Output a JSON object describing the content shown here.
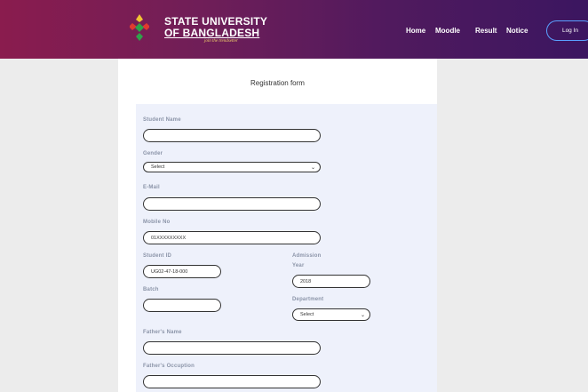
{
  "header": {
    "brand_line1": "STATE UNIVERSITY",
    "brand_line2": "OF BANGLADESH",
    "brand_tagline": "join the trendsetter",
    "nav": [
      "Home",
      "Moodle",
      "Result",
      "Notice"
    ],
    "login_label": "Log In"
  },
  "form": {
    "title": "Registration form",
    "student_name": {
      "label": "Student Name",
      "value": ""
    },
    "gender": {
      "label": "Gender",
      "value": "Select"
    },
    "email": {
      "label": "E-Mail",
      "value": ""
    },
    "mobile": {
      "label": "Mobile No",
      "value": "01XXXXXXXXX"
    },
    "student_id": {
      "label": "Student ID",
      "value": "UG02-47-18-000"
    },
    "admission_year": {
      "label_line1": "Admission",
      "label_line2": "Year",
      "value": "2018"
    },
    "batch": {
      "label": "Batch",
      "value": ""
    },
    "department": {
      "label": "Department",
      "value": "Select"
    },
    "fathers_name": {
      "label": "Father's Name",
      "value": ""
    },
    "fathers_occupation": {
      "label": "Father's Occuption",
      "value": ""
    }
  },
  "colors": {
    "header_gradient_start": "#8a1c4e",
    "header_gradient_end": "#3b1660",
    "form_background": "#eef1fb",
    "login_border": "#5aa0ff"
  }
}
